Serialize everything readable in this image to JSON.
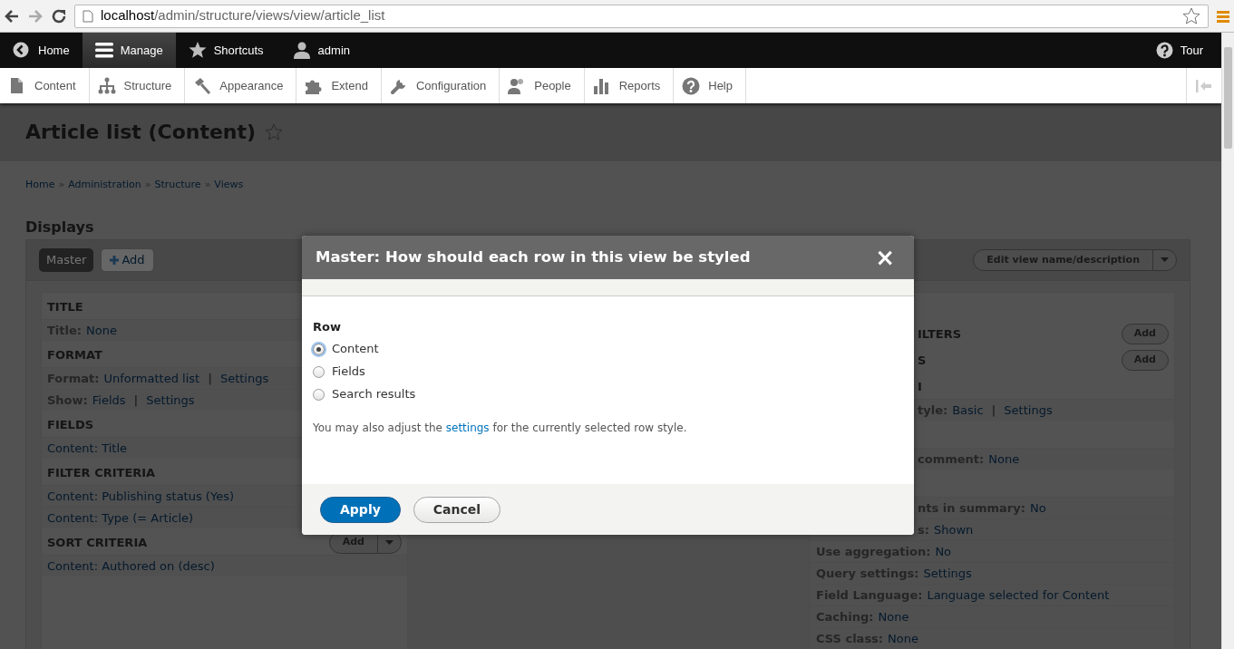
{
  "browser": {
    "url_host": "localhost",
    "url_path": "/admin/structure/views/view/article_list"
  },
  "toolbar": {
    "items": [
      {
        "label": "Home",
        "selected": false
      },
      {
        "label": "Manage",
        "selected": true
      },
      {
        "label": "Shortcuts",
        "selected": false
      },
      {
        "label": "admin",
        "selected": false
      }
    ],
    "tour": "Tour"
  },
  "tray": {
    "items": [
      "Content",
      "Structure",
      "Appearance",
      "Extend",
      "Configuration",
      "People",
      "Reports",
      "Help"
    ]
  },
  "page": {
    "title": "Article list (Content)",
    "breadcrumb": [
      {
        "kind": "link",
        "text": "Home"
      },
      {
        "kind": "separator",
        "text": "»"
      },
      {
        "kind": "link",
        "text": "Administration"
      },
      {
        "kind": "separator",
        "text": "»"
      },
      {
        "kind": "link",
        "text": "Structure"
      },
      {
        "kind": "separator",
        "text": "»"
      },
      {
        "kind": "link",
        "text": "Views"
      }
    ],
    "displays_heading": "Displays",
    "display_tabs": [
      {
        "label": "Master",
        "selected": true
      }
    ],
    "add_display": "Add",
    "edit_button": "Edit view name/description",
    "left_column": [
      {
        "kind": "heading",
        "text": "TITLE"
      },
      {
        "kind": "row",
        "parts": [
          {
            "kind": "label",
            "text": "Title:"
          },
          {
            "kind": "link",
            "text": "None"
          }
        ]
      },
      {
        "kind": "heading",
        "text": "FORMAT"
      },
      {
        "kind": "row",
        "parts": [
          {
            "kind": "label",
            "text": "Format:"
          },
          {
            "kind": "link",
            "text": "Unformatted list"
          },
          {
            "kind": "separator",
            "text": "|"
          },
          {
            "kind": "link",
            "text": "Settings"
          }
        ]
      },
      {
        "kind": "row",
        "parts": [
          {
            "kind": "label",
            "text": "Show:"
          },
          {
            "kind": "link",
            "text": "Fields"
          },
          {
            "kind": "separator",
            "text": "|"
          },
          {
            "kind": "link",
            "text": "Settings"
          }
        ]
      },
      {
        "kind": "heading",
        "text": "FIELDS"
      },
      {
        "kind": "row",
        "parts": [
          {
            "kind": "link",
            "text": "Content: Title"
          }
        ]
      },
      {
        "kind": "heading",
        "text": "FILTER CRITERIA"
      },
      {
        "kind": "row",
        "parts": [
          {
            "kind": "link",
            "text": "Content: Publishing status (Yes)"
          }
        ]
      },
      {
        "kind": "row",
        "parts": [
          {
            "kind": "link",
            "text": "Content: Type (= Article)"
          }
        ]
      },
      {
        "kind": "heading",
        "text": "SORT CRITERIA",
        "add_button": "Add"
      },
      {
        "kind": "row",
        "parts": [
          {
            "kind": "link",
            "text": "Content: Authored on (desc)"
          }
        ]
      }
    ],
    "right_column": [
      {
        "kind": "spacer"
      },
      {
        "kind": "heading",
        "text": "ILTERS",
        "cut": true,
        "add_button": "Add"
      },
      {
        "kind": "heading",
        "text": "S",
        "cut": true,
        "add_button": "Add"
      },
      {
        "kind": "heading",
        "text": "I",
        "cut": true
      },
      {
        "kind": "row",
        "cut": true,
        "parts": [
          {
            "kind": "label",
            "text": "tyle:"
          },
          {
            "kind": "link",
            "text": "Basic"
          },
          {
            "kind": "separator",
            "text": "|"
          },
          {
            "kind": "link",
            "text": "Settings"
          }
        ]
      },
      {
        "kind": "spacer"
      },
      {
        "kind": "row",
        "cut": true,
        "parts": [
          {
            "kind": "label",
            "text": "comment:"
          },
          {
            "kind": "link",
            "text": "None"
          }
        ]
      },
      {
        "kind": "spacer"
      },
      {
        "kind": "row",
        "cut": true,
        "parts": [
          {
            "kind": "label",
            "text": "nts in summary:"
          },
          {
            "kind": "link",
            "text": "No"
          }
        ]
      },
      {
        "kind": "row",
        "cut": true,
        "parts": [
          {
            "kind": "label",
            "text": "s:"
          },
          {
            "kind": "link",
            "text": "Shown"
          }
        ]
      },
      {
        "kind": "row",
        "cut": false,
        "parts": [
          {
            "kind": "label",
            "text": "Use aggregation:"
          },
          {
            "kind": "link",
            "text": "No"
          }
        ]
      },
      {
        "kind": "row",
        "cut": false,
        "parts": [
          {
            "kind": "label",
            "text": "Query settings:"
          },
          {
            "kind": "link",
            "text": "Settings"
          }
        ]
      },
      {
        "kind": "row",
        "cut": false,
        "parts": [
          {
            "kind": "label",
            "text": "Field Language:"
          },
          {
            "kind": "link",
            "text": "Language selected for Content"
          }
        ]
      },
      {
        "kind": "row",
        "cut": false,
        "parts": [
          {
            "kind": "label",
            "text": "Caching:"
          },
          {
            "kind": "link",
            "text": "None"
          }
        ]
      },
      {
        "kind": "row",
        "cut": false,
        "parts": [
          {
            "kind": "label",
            "text": "CSS class:"
          },
          {
            "kind": "link",
            "text": "None"
          }
        ]
      }
    ]
  },
  "dialog": {
    "title": "Master: How should each row in this view be styled",
    "close": "×",
    "group_label": "Row",
    "options": [
      {
        "label": "Content",
        "selected": true
      },
      {
        "label": "Fields",
        "selected": false
      },
      {
        "label": "Search results",
        "selected": false
      }
    ],
    "help": {
      "before": "You may also adjust the ",
      "link": "settings",
      "after": " for the currently selected row style."
    },
    "buttons": [
      {
        "label": "Apply",
        "kind": "primary"
      },
      {
        "label": "Cancel",
        "kind": "secondary"
      }
    ]
  }
}
